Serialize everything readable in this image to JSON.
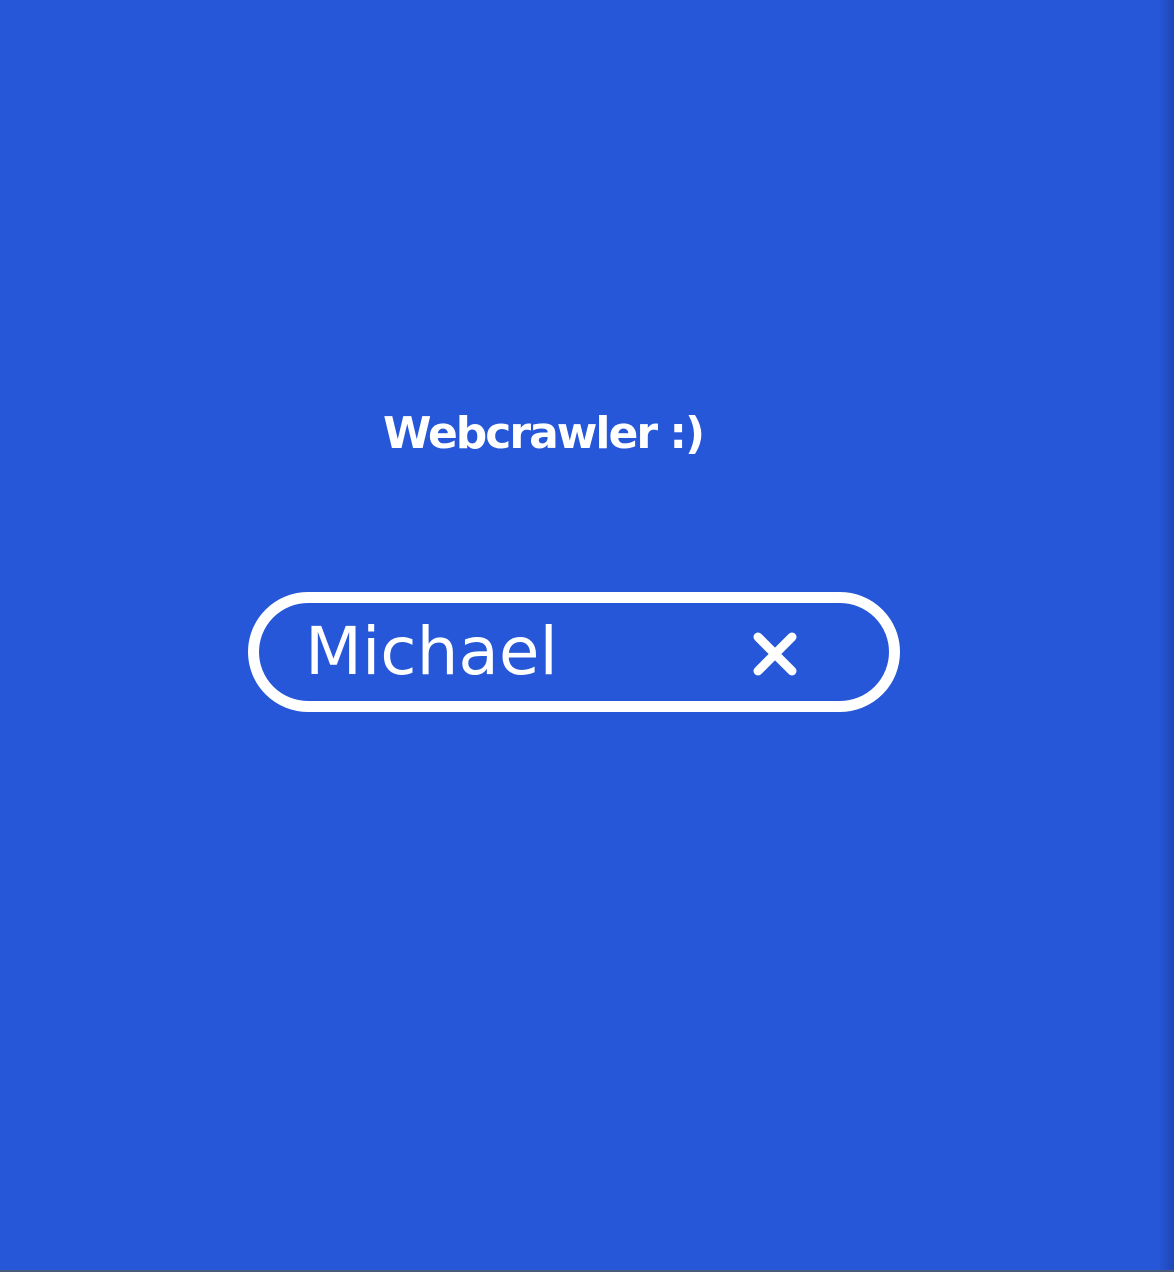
{
  "header": {
    "title": "Webcrawler :)"
  },
  "search": {
    "value": "Michael",
    "clear_icon": "close-icon"
  },
  "colors": {
    "background": "#2657d8",
    "foreground": "#ffffff"
  }
}
